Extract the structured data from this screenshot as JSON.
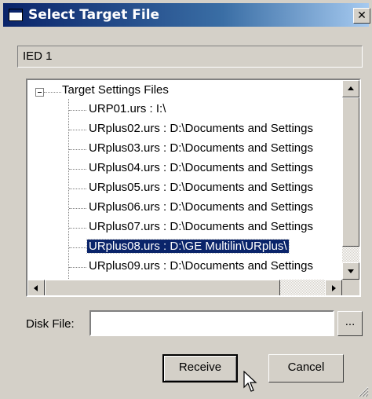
{
  "window": {
    "title": "Select Target File",
    "close_glyph": "✕",
    "title_icon": "window-icon"
  },
  "ied_field": {
    "value": "IED 1"
  },
  "tree": {
    "expander_glyph": "minus",
    "root_label": "Target Settings Files",
    "items": [
      {
        "label": "URP01.urs : I:\\",
        "selected": false
      },
      {
        "label": "URplus02.urs : D:\\Documents and Settings",
        "selected": false
      },
      {
        "label": "URplus03.urs : D:\\Documents and Settings",
        "selected": false
      },
      {
        "label": "URplus04.urs : D:\\Documents and Settings",
        "selected": false
      },
      {
        "label": "URplus05.urs : D:\\Documents and Settings",
        "selected": false
      },
      {
        "label": "URplus06.urs : D:\\Documents and Settings",
        "selected": false
      },
      {
        "label": "URplus07.urs : D:\\Documents and Settings",
        "selected": false
      },
      {
        "label": "URplus08.urs : D:\\GE Multilin\\URplus\\",
        "selected": true
      },
      {
        "label": "URplus09.urs : D:\\Documents and Settings",
        "selected": false
      }
    ]
  },
  "disk_file": {
    "label": "Disk File:",
    "value": "",
    "browse_label": "..."
  },
  "buttons": {
    "receive": "Receive",
    "cancel": "Cancel"
  },
  "colors": {
    "title_start": "#0a246a",
    "title_end": "#a6caf0",
    "face": "#d4d0c8",
    "selection": "#0a246a"
  }
}
